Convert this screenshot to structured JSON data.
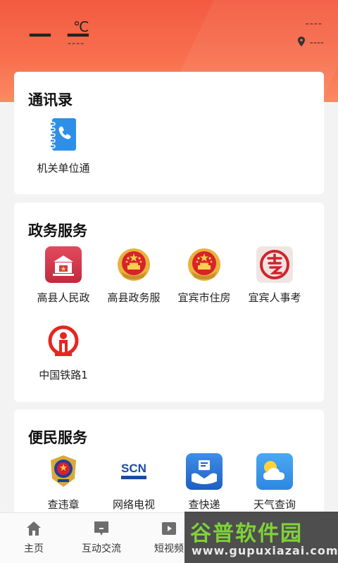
{
  "header": {
    "temperature": "— —",
    "unit": "℃",
    "weather": "----",
    "date": "----",
    "location": "----"
  },
  "contacts": {
    "title": "通讯录",
    "items": [
      {
        "label": "机关单位通",
        "icon": "phone-book-icon"
      }
    ]
  },
  "gov": {
    "title": "政务服务",
    "items": [
      {
        "label": "高县人民政",
        "icon": "government-building-icon"
      },
      {
        "label": "高县政务服",
        "icon": "national-emblem-icon"
      },
      {
        "label": "宜宾市住房",
        "icon": "national-emblem-icon"
      },
      {
        "label": "宜宾人事考",
        "icon": "seal-stamp-icon"
      },
      {
        "label": "中国铁路1",
        "icon": "railway-logo-icon"
      }
    ]
  },
  "service": {
    "title": "便民服务",
    "items": [
      {
        "label": "查违章",
        "icon": "police-emblem-icon"
      },
      {
        "label": "网络电视",
        "icon": "scn-logo-icon",
        "logo_text": "SCN"
      },
      {
        "label": "查快递",
        "icon": "express-delivery-icon"
      },
      {
        "label": "天气查询",
        "icon": "weather-icon"
      }
    ]
  },
  "tabbar": [
    {
      "label": "主页",
      "icon": "home-icon"
    },
    {
      "label": "互动交流",
      "icon": "chat-icon"
    },
    {
      "label": "短视频",
      "icon": "video-icon"
    }
  ],
  "watermark": {
    "text": "谷普软件园",
    "url": "www.gupuxiazai.com"
  },
  "colors": {
    "header": "#f35a40",
    "accent": "#e5393b",
    "tab_icon": "#6d6d6d"
  }
}
